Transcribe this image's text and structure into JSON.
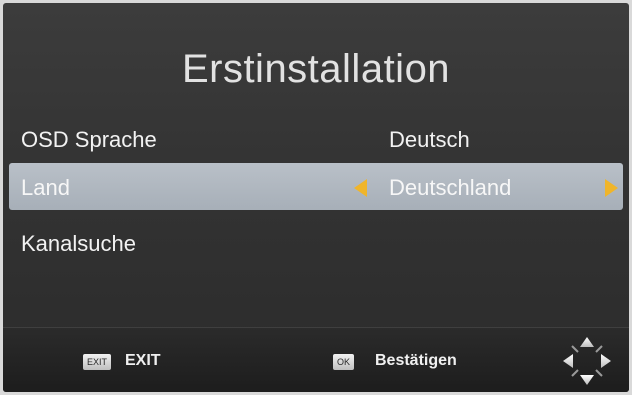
{
  "title": "Erstinstallation",
  "menu": [
    {
      "label": "OSD Sprache",
      "value": "Deutsch"
    },
    {
      "label": "Land",
      "value": "Deutschland"
    },
    {
      "label": "Kanalsuche",
      "value": ""
    }
  ],
  "footer": {
    "exit_badge": "EXIT",
    "exit_label": "EXIT",
    "ok_badge": "OK",
    "ok_label": "Bestätigen"
  },
  "icons": {
    "left_arrow": "arrow-left-icon",
    "right_arrow": "arrow-right-icon",
    "nav_pad": "dpad-icon"
  },
  "colors": {
    "selection_bar": "#b3bac3",
    "arrow_accent": "#f0b52a"
  }
}
